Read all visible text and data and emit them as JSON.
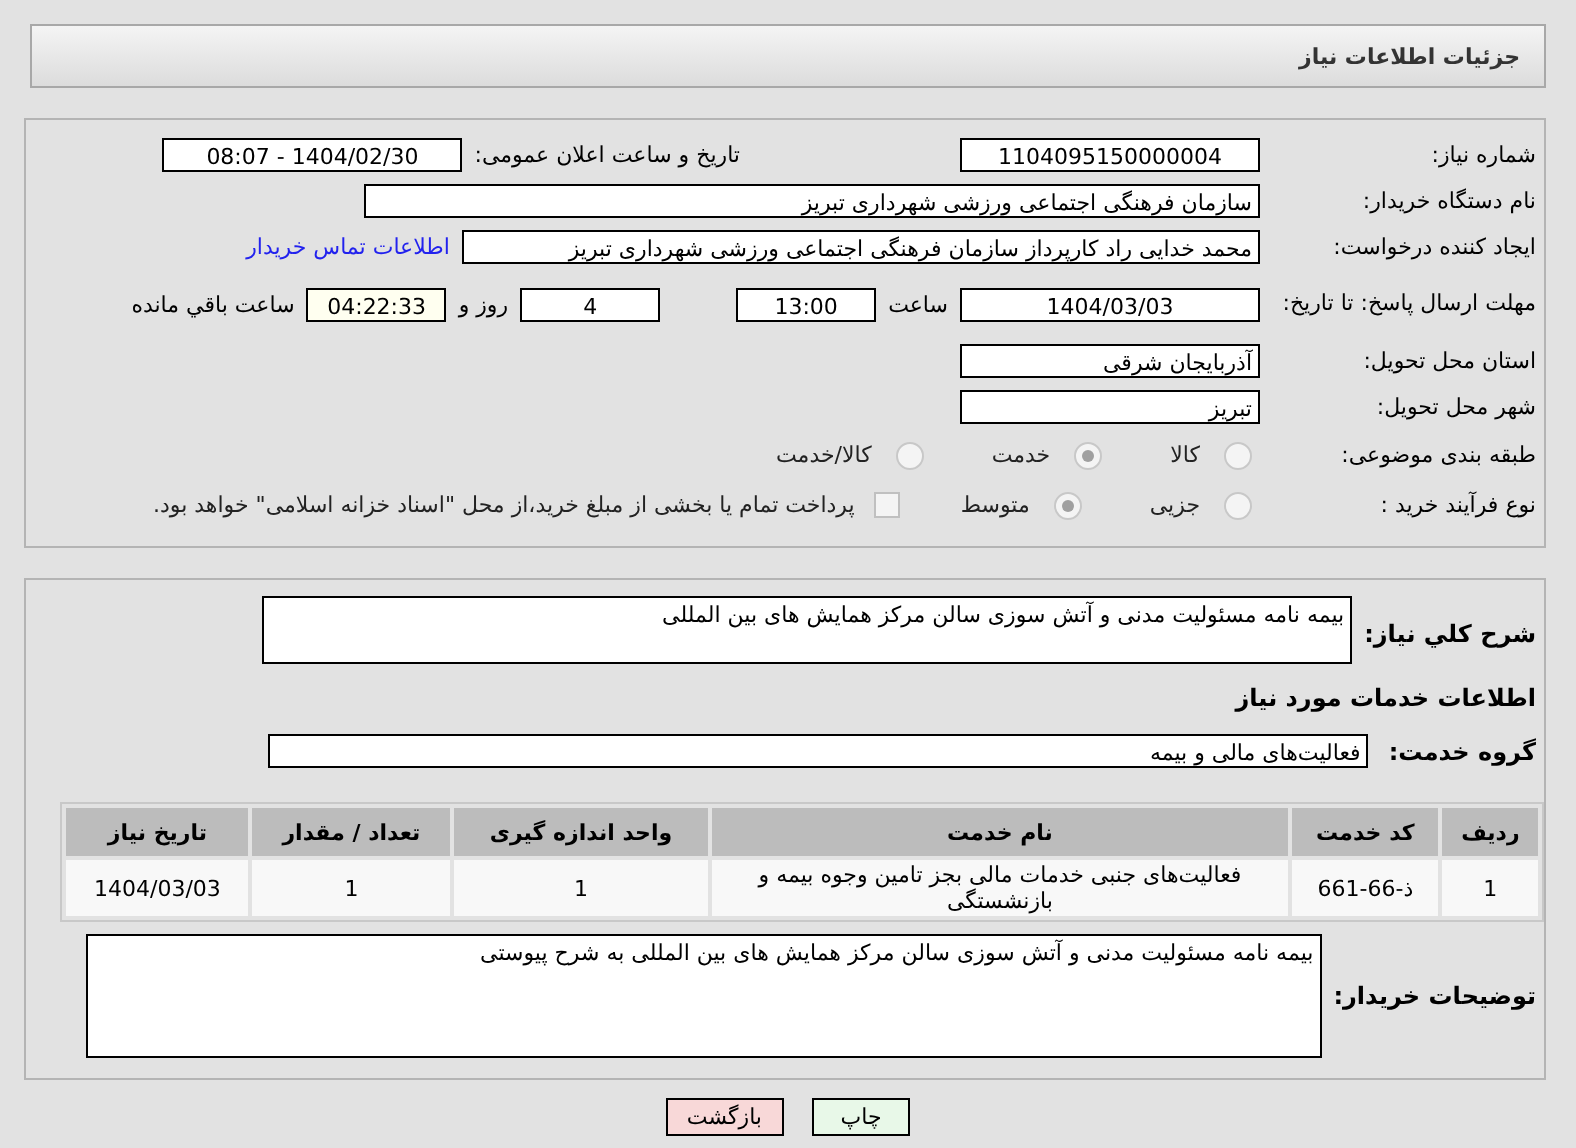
{
  "header": {
    "title": "جزئیات اطلاعات نیاز"
  },
  "need_number": {
    "label": "شماره نیاز:",
    "value": "1104095150000004"
  },
  "announce": {
    "label": "تاریخ و ساعت اعلان عمومی:",
    "value": "1404/02/30 - 08:07"
  },
  "buyer_org": {
    "label": "نام دستگاه خریدار:",
    "value": "سازمان فرهنگی اجتماعی ورزشی شهرداری تبریز"
  },
  "creator": {
    "label": "ایجاد کننده درخواست:",
    "value": "محمد خدایی راد کارپرداز سازمان فرهنگی اجتماعی ورزشی شهرداری تبریز",
    "link": "اطلاعات تماس خریدار"
  },
  "deadline": {
    "label": "مهلت ارسال پاسخ: تا تاریخ:",
    "date": "1404/03/03",
    "time_label": "ساعت",
    "time": "13:00",
    "days": "4",
    "days_label": "روز و",
    "remaining": "04:22:33",
    "remaining_label": "ساعت باقي مانده"
  },
  "province": {
    "label": "استان محل تحویل:",
    "value": "آذربایجان شرقی"
  },
  "city": {
    "label": "شهر محل تحویل:",
    "value": "تبریز"
  },
  "category": {
    "label": "طبقه بندی موضوعی:",
    "options": [
      {
        "label": "کالا",
        "selected": false
      },
      {
        "label": "خدمت",
        "selected": true
      },
      {
        "label": "کالا/خدمت",
        "selected": false
      }
    ]
  },
  "process": {
    "label": "نوع فرآیند خرید :",
    "options": [
      {
        "label": "جزیی",
        "selected": false
      },
      {
        "label": "متوسط",
        "selected": true
      }
    ],
    "treasury": {
      "label": "پرداخت تمام یا بخشی از مبلغ خرید،از محل \"اسناد خزانه اسلامی\" خواهد بود.",
      "checked": false
    }
  },
  "description": {
    "label": "شرح کلي نياز:",
    "value": "بیمه نامه مسئولیت مدنی و آتش سوزی سالن مرکز همایش های بین المللی"
  },
  "services_title": "اطلاعات خدمات مورد نیاز",
  "service_group": {
    "label": "گروه خدمت:",
    "value": "فعالیت‌های مالی و بیمه"
  },
  "table": {
    "columns": [
      "ردیف",
      "کد خدمت",
      "نام خدمت",
      "واحد اندازه گیری",
      "تعداد / مقدار",
      "تاریخ نیاز"
    ],
    "rows": [
      [
        "1",
        "ذ-66-661",
        "فعالیت‌های جنبی خدمات مالی بجز تامین وجوه بیمه و بازنشستگی",
        "1",
        "1",
        "1404/03/03"
      ]
    ]
  },
  "buyer_notes": {
    "label": "توضیحات خریدار:",
    "value": "بیمه نامه مسئولیت مدنی و آتش سوزی سالن مرکز همایش های بین المللی به شرح پیوستی"
  },
  "buttons": [
    {
      "label": "چاپ",
      "kind": "print"
    },
    {
      "label": "بازگشت",
      "kind": "back"
    }
  ]
}
